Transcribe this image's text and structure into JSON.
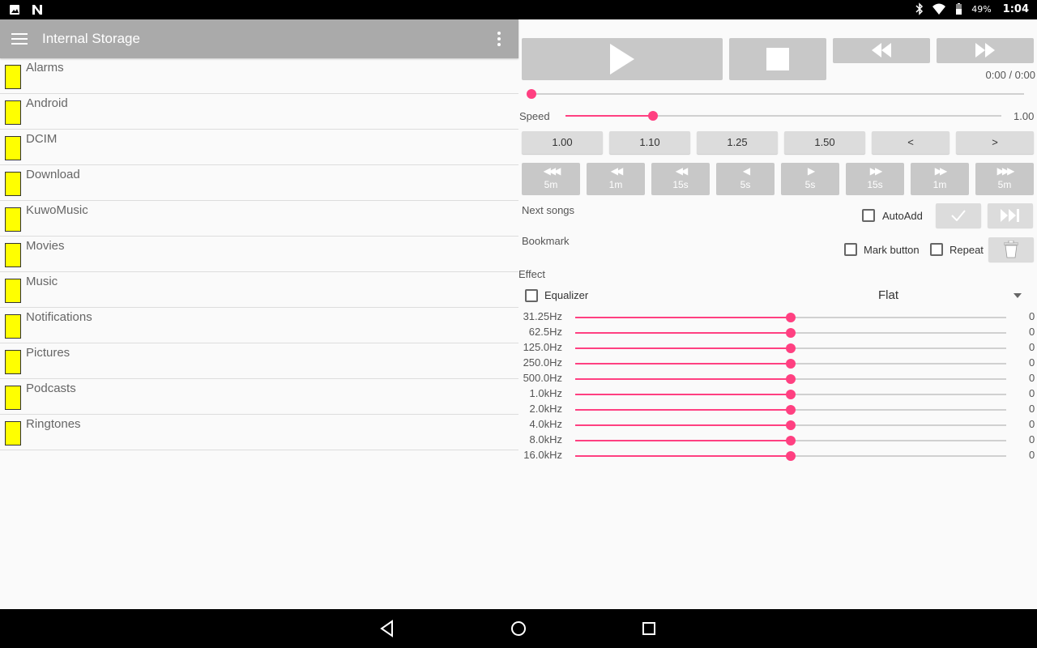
{
  "status_bar": {
    "battery": "49%",
    "time": "1:04"
  },
  "toolbar": {
    "title": "Internal Storage"
  },
  "files": [
    "Alarms",
    "Android",
    "DCIM",
    "Download",
    "KuwoMusic",
    "Movies",
    "Music",
    "Notifications",
    "Pictures",
    "Podcasts",
    "Ringtones"
  ],
  "player": {
    "time": "0:00 / 0:00",
    "progress": 0,
    "speed_label": "Speed",
    "speed_value": "1.00",
    "speed_fraction": 0.2,
    "speed_buttons": [
      "1.00",
      "1.10",
      "1.25",
      "1.50",
      "<",
      ">"
    ],
    "seek_buttons": [
      {
        "glyph": "◀◀◀",
        "num": "5m"
      },
      {
        "glyph": "◀◀",
        "num": "1m"
      },
      {
        "glyph": "◀◀",
        "num": "15s"
      },
      {
        "glyph": "◀",
        "num": "5s"
      },
      {
        "glyph": "▶",
        "num": "5s"
      },
      {
        "glyph": "▶▶",
        "num": "15s"
      },
      {
        "glyph": "▶▶",
        "num": "1m"
      },
      {
        "glyph": "▶▶▶",
        "num": "5m"
      }
    ]
  },
  "next_songs": {
    "label": "Next songs",
    "autoadd": "AutoAdd"
  },
  "bookmark": {
    "label": "Bookmark",
    "mark_button": "Mark button",
    "repeat": "Repeat"
  },
  "effect": {
    "label": "Effect",
    "equalizer": "Equalizer",
    "preset": "Flat",
    "bands": [
      {
        "freq": "31.25Hz",
        "value": "0"
      },
      {
        "freq": "62.5Hz",
        "value": "0"
      },
      {
        "freq": "125.0Hz",
        "value": "0"
      },
      {
        "freq": "250.0Hz",
        "value": "0"
      },
      {
        "freq": "500.0Hz",
        "value": "0"
      },
      {
        "freq": "1.0kHz",
        "value": "0"
      },
      {
        "freq": "2.0kHz",
        "value": "0"
      },
      {
        "freq": "4.0kHz",
        "value": "0"
      },
      {
        "freq": "8.0kHz",
        "value": "0"
      },
      {
        "freq": "16.0kHz",
        "value": "0"
      }
    ]
  },
  "colors": {
    "accent": "#ff4081",
    "toolbar": "#aaaaaa",
    "folder": "#ffff00"
  },
  "icons": [
    "menu-icon",
    "overflow-icon",
    "play-icon",
    "stop-icon",
    "rewind-icon",
    "fast-forward-icon",
    "check-icon",
    "skip-next-icon",
    "trash-icon",
    "dropdown-icon",
    "folder-icon"
  ]
}
